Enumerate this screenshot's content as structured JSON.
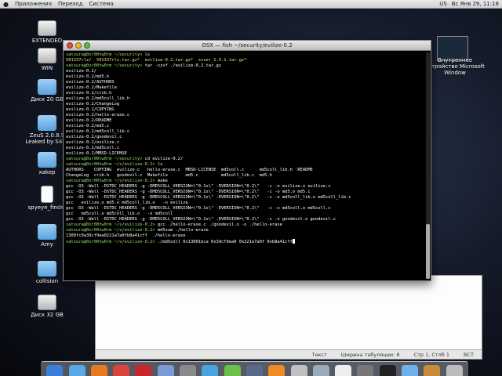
{
  "topbar": {
    "apple_icon": "apple-icon",
    "menus": [
      "Приложения",
      "Переход",
      "Система"
    ],
    "status": [
      "US",
      "Вс Янв 29, 11:18"
    ]
  },
  "desktop_icons": [
    {
      "label": "EXTENDED",
      "icon": "disk-icon"
    },
    {
      "label": "WIN",
      "icon": "disk-icon"
    },
    {
      "label": "Диск 20 GB",
      "icon": "folder-icon"
    },
    {
      "label": "ZeuS 2.0.8.9 Leaked by S4cu",
      "icon": "folder-icon"
    },
    {
      "label": "xakep",
      "icon": "folder-icon"
    },
    {
      "label": "spyeye_finder",
      "icon": "document-icon"
    },
    {
      "label": "Amy",
      "icon": "folder-icon"
    },
    {
      "label": "collision",
      "icon": "folder-icon"
    },
    {
      "label": "Диск 32 GB",
      "icon": "disk-icon"
    }
  ],
  "right_icon": {
    "label": "Внутреннее устройство Microsoft Window"
  },
  "window": {
    "title": "OSX — fish  ~/security/evilize-0.2"
  },
  "terminal_lines": [
    "satsura@0xr00tw0rm ~/security> ls",
    "501337rlz/  501337rlz.tar.gz*  evilize-0.2.tar.gz*  xsser_1.5-1.tar.gz*",
    "satsura@0xr00tw0rm ~/security> tar -xzvf ./evilize-0.2.tar.gz",
    "evilize-0.2/",
    "evilize-0.2/md5.h",
    "evilize-0.2/AUTHORS",
    "evilize-0.2/Makefile",
    "evilize-0.2/crib.h",
    "evilize-0.2/md5coll_lib.h",
    "evilize-0.2/ChangeLog",
    "evilize-0.2/COPYING",
    "evilize-0.2/hello-erase.c",
    "evilize-0.2/README",
    "evilize-0.2/md5.c",
    "evilize-0.2/md5coll_lib.c",
    "evilize-0.2/goodevil.c",
    "evilize-0.2/evilize.c",
    "evilize-0.2/md5coll.c",
    "evilize-0.2/MBSD-LICENSE",
    "satsura@0xr00tw0rm ~/security> cd evilize-0.2/",
    "satsura@0xr00tw0rm ~/s/evilize-0.2> ls",
    "AUTHORS    COPYING  evilize.c   hello-erase.c  MBSD-LICENSE  md5coll.c      md5coll_lib.h  README",
    "ChangeLog  crib.h   goodevil.c  Makefile       md5.c         md5coll_lib.c  md5.h",
    "satsura@0xr00tw0rm ~/s/evilize-0.2> make",
    "gcc -O3 -Wall -DSTDC_HEADERS -g -DMD5COLL_VERSION=\\\"0.1s\\\" -DVERSION=\\\"0.2\\\"   -c -o evilize.o evilize.c",
    "gcc -O3 -Wall -DSTDC_HEADERS -g -DMD5COLL_VERSION=\\\"0.1s\\\" -DVERSION=\\\"0.2\\\"   -c -o md5.o md5.c",
    "gcc -O3 -Wall -DSTDC_HEADERS -g -DMD5COLL_VERSION=\\\"0.1s\\\" -DVERSION=\\\"0.2\\\"   -c -o md5coll_lib.o md5coll_lib.c",
    "gcc   evilize.o md5.o md5coll_lib.o   -o evilize",
    "gcc -O3 -Wall -DSTDC_HEADERS -g -DMD5COLL_VERSION=\\\"0.1s\\\" -DVERSION=\\\"0.2\\\"   -c -o md5coll.o md5coll.c",
    "gcc   md5coll.o md5coll_lib.o   -o md5coll",
    "gcc -O3 -Wall -DSTDC_HEADERS -g -DMD5COLL_VERSION=\\\"0.1s\\\" -DVERSION=\\\"0.2\\\"   -c -o goodevil.o goodevil.c",
    "satsura@0xr00tw0rm ~/s/evilize-0.2> gcc ./hello-erase.c ./goodevil.o -o ./hello-erase",
    "satsura@0xr00tw0rm ~/s/evilize-0.2> md5sum ./hello-erase",
    "1300fc9a39cf9ea0221a7a0fb8a41cff  ./hello-erase",
    "satsura@0xr00tw0rm ~/s/evilize-0.2> ./md5coll 0x13001bca 0x39cf9ea0 0x221a7a0f 0xb8a41cff"
  ],
  "editor_status": {
    "mode": "Текст",
    "tab_width": "Ширина табуляции: 8",
    "position": "Стр 1, Стлб 1",
    "insert": "ВСТ"
  },
  "dock_icons": [
    "download-icon",
    "finder-icon",
    "firefox-icon",
    "chrome-icon",
    "opera-icon",
    "photos-icon",
    "gear-icon",
    "safari-icon",
    "itunes-icon",
    "quicktime-icon",
    "vlc-icon",
    "tools-icon",
    "preview-icon",
    "textedit-icon",
    "calculator-icon",
    "terminal-icon",
    "folder-icon",
    "package-icon",
    "trash-icon"
  ],
  "colors": {
    "prompt": "#9ee36b",
    "archive": "#f2e277"
  }
}
